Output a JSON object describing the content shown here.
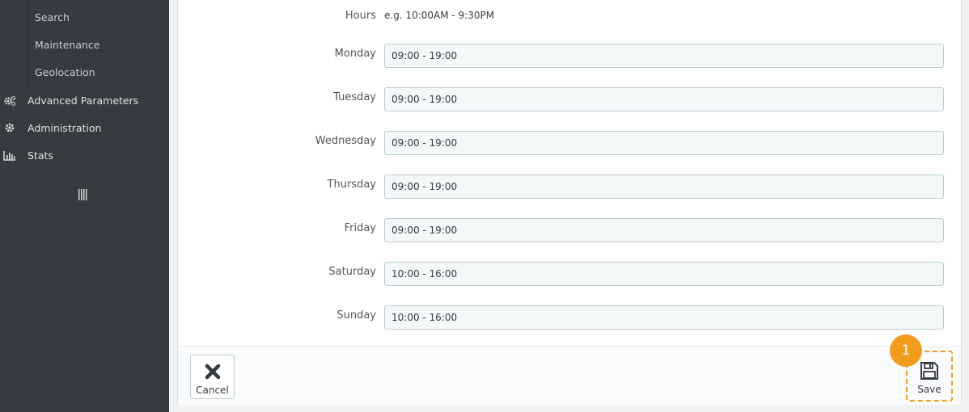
{
  "sidebar": {
    "sub_items": [
      "Search",
      "Maintenance",
      "Geolocation"
    ],
    "items": [
      {
        "label": "Advanced Parameters",
        "icon": "gears-icon"
      },
      {
        "label": "Administration",
        "icon": "gear-icon"
      },
      {
        "label": "Stats",
        "icon": "bar-chart-icon"
      }
    ],
    "collapse_icon": "collapse-sidebar-icon"
  },
  "form": {
    "hours_label": "Hours",
    "hours_hint": "e.g. 10:00AM - 9:30PM",
    "days": [
      {
        "label": "Monday",
        "value": "09:00 - 19:00"
      },
      {
        "label": "Tuesday",
        "value": "09:00 - 19:00"
      },
      {
        "label": "Wednesday",
        "value": "09:00 - 19:00"
      },
      {
        "label": "Thursday",
        "value": "09:00 - 19:00"
      },
      {
        "label": "Friday",
        "value": "09:00 - 19:00"
      },
      {
        "label": "Saturday",
        "value": "10:00 - 16:00"
      },
      {
        "label": "Sunday",
        "value": "10:00 - 16:00"
      }
    ]
  },
  "footer": {
    "cancel_label": "Cancel",
    "save_label": "Save",
    "step_badge": "1"
  },
  "colors": {
    "sidebar_bg": "#363a41",
    "highlight": "#f39c1b",
    "input_bg": "#f5f8f9"
  }
}
